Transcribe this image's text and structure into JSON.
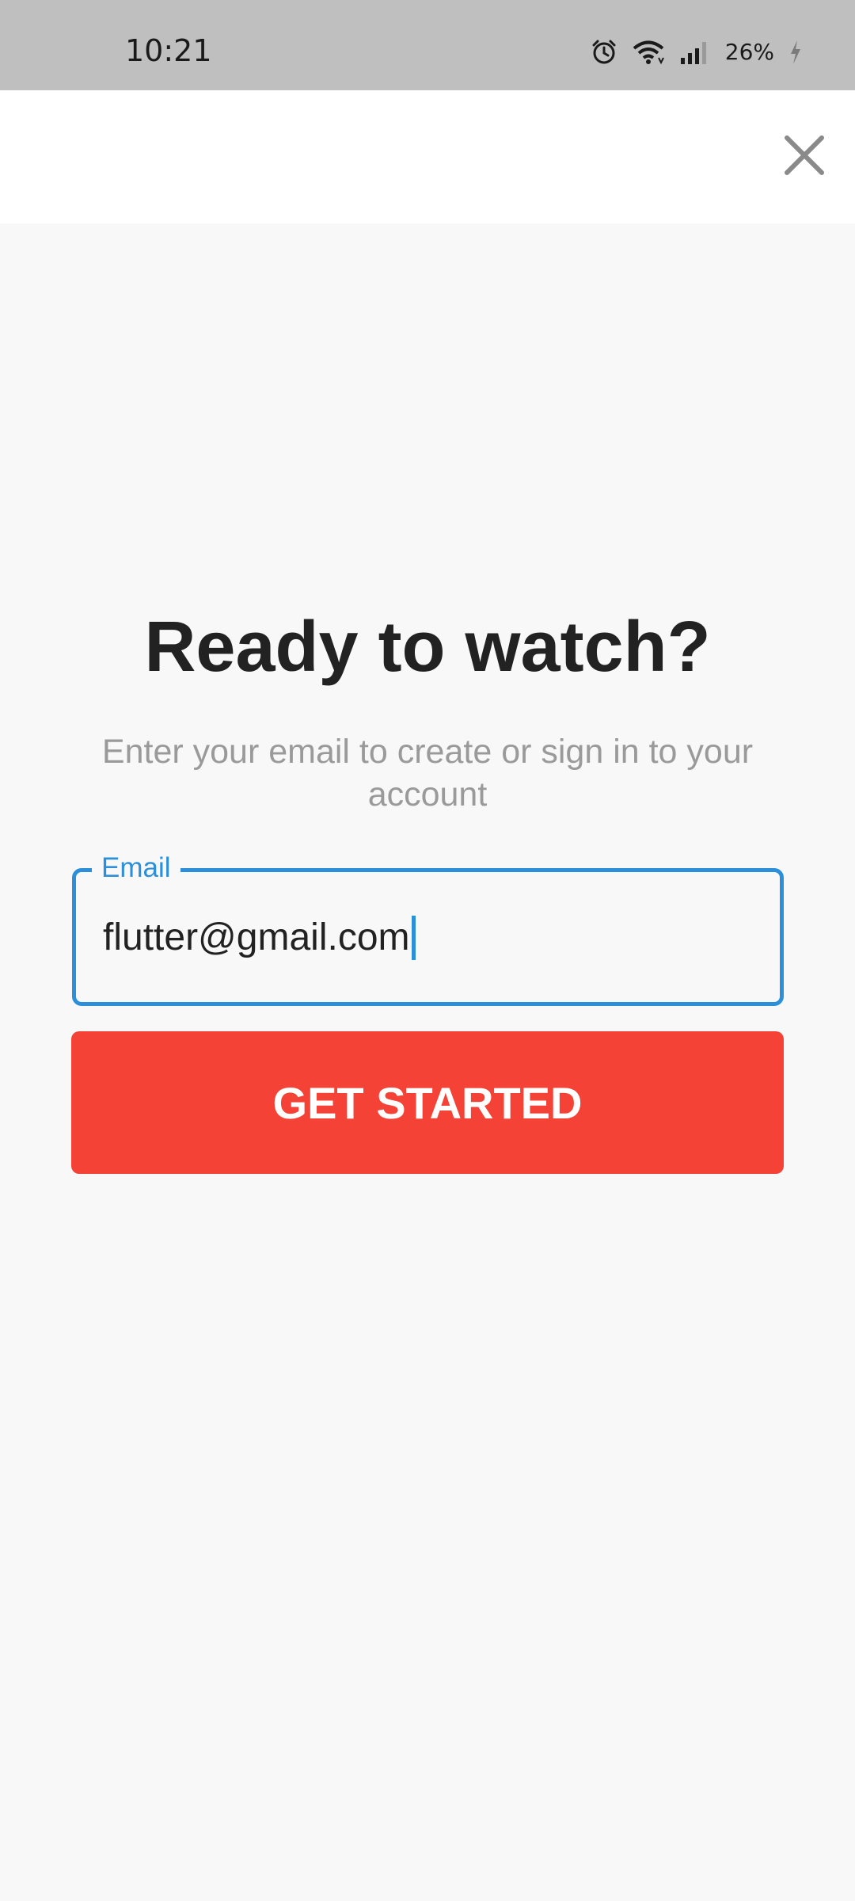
{
  "status_bar": {
    "time": "10:21",
    "battery": "26%",
    "icons": [
      "alarm-icon",
      "wifi-icon",
      "signal-icon",
      "charging-icon"
    ]
  },
  "app_bar": {
    "close_icon": "close-icon"
  },
  "main": {
    "title": "Ready to watch?",
    "subtitle": "Enter your email to create or sign in to your account",
    "email_field": {
      "label": "Email",
      "value": "flutter@gmail.com"
    },
    "cta_label": "GET STARTED"
  },
  "colors": {
    "accent": "#2b8fd9",
    "primary_button": "#f44336",
    "status_bar": "#bfbfbf"
  }
}
